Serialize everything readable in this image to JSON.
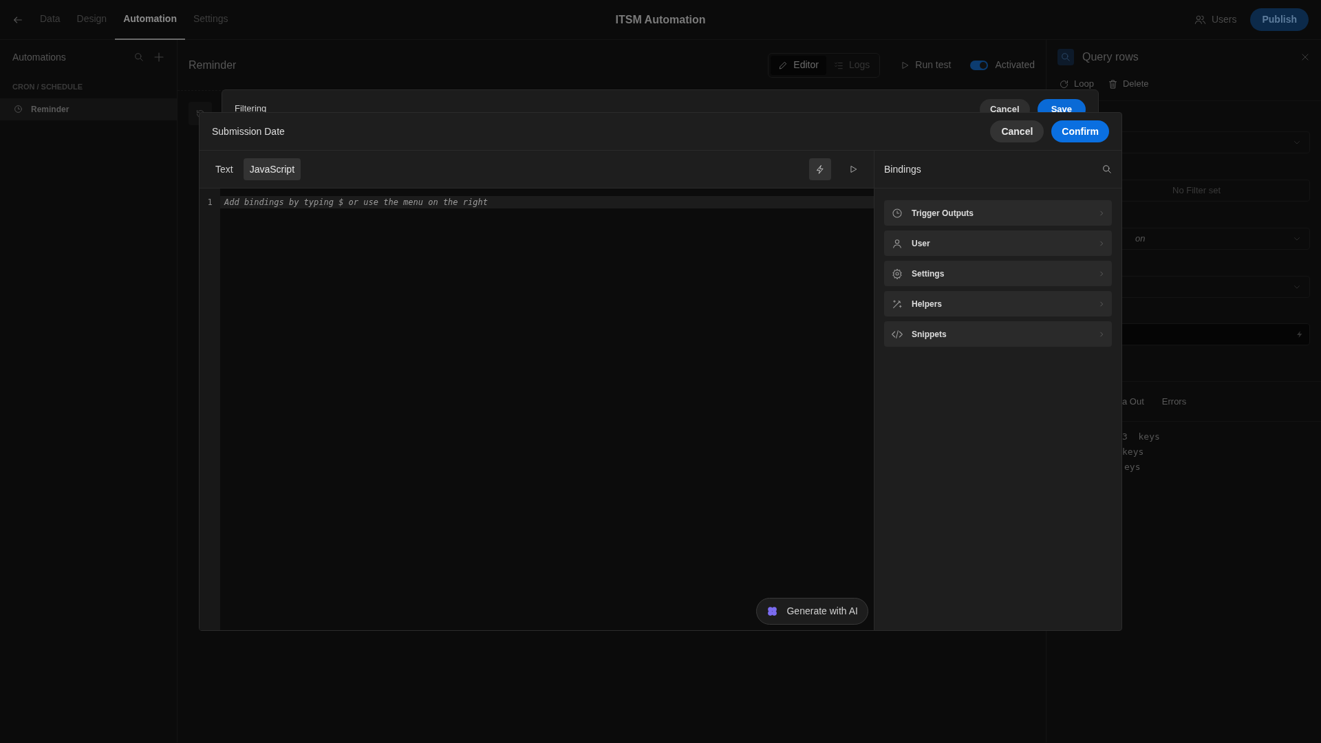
{
  "top_bar": {
    "tabs": [
      {
        "label": "Data",
        "selected": false
      },
      {
        "label": "Design",
        "selected": false
      },
      {
        "label": "Automation",
        "selected": true
      },
      {
        "label": "Settings",
        "selected": false
      }
    ],
    "title": "ITSM Automation",
    "users": "Users",
    "publish": "Publish"
  },
  "sidebar": {
    "title": "Automations",
    "section": "CRON / SCHEDULE",
    "items": [
      {
        "label": "Reminder",
        "selected": true
      }
    ]
  },
  "automation_header": {
    "title": "Reminder",
    "view_tabs": [
      {
        "label": "Editor",
        "selected": true
      },
      {
        "label": "Logs",
        "selected": false
      }
    ],
    "run_test": "Run test",
    "activated": {
      "label": "Activated",
      "on": true
    }
  },
  "step_panel": {
    "title": "Query rows",
    "actions": [
      {
        "label": "Loop",
        "kind": "loop"
      },
      {
        "label": "Delete",
        "kind": "trash"
      }
    ],
    "filter_text": "No Filter set",
    "partial_field": "on",
    "tabs": [
      "a Out",
      "Errors"
    ],
    "output_lines": [
      "3  keys",
      "keys",
      "eys"
    ]
  },
  "filter_dialog": {
    "title": "Filtering",
    "cancel": "Cancel",
    "save": "Save"
  },
  "binding_dialog": {
    "title": "Submission Date",
    "cancel": "Cancel",
    "confirm": "Confirm",
    "modes": [
      {
        "label": "Text",
        "selected": false
      },
      {
        "label": "JavaScript",
        "selected": true
      }
    ],
    "bindings_toggle_on": true,
    "code_lines": [
      {
        "number": "1",
        "text": "Add bindings by typing $ or use the menu on the right",
        "placeholder": true
      }
    ],
    "generate": "Generate with AI",
    "bindings": {
      "title": "Bindings",
      "items": [
        {
          "label": "Trigger Outputs",
          "kind": "clock"
        },
        {
          "label": "User",
          "kind": "user"
        },
        {
          "label": "Settings",
          "kind": "gear"
        },
        {
          "label": "Helpers",
          "kind": "wand"
        },
        {
          "label": "Snippets",
          "kind": "code"
        }
      ]
    }
  }
}
